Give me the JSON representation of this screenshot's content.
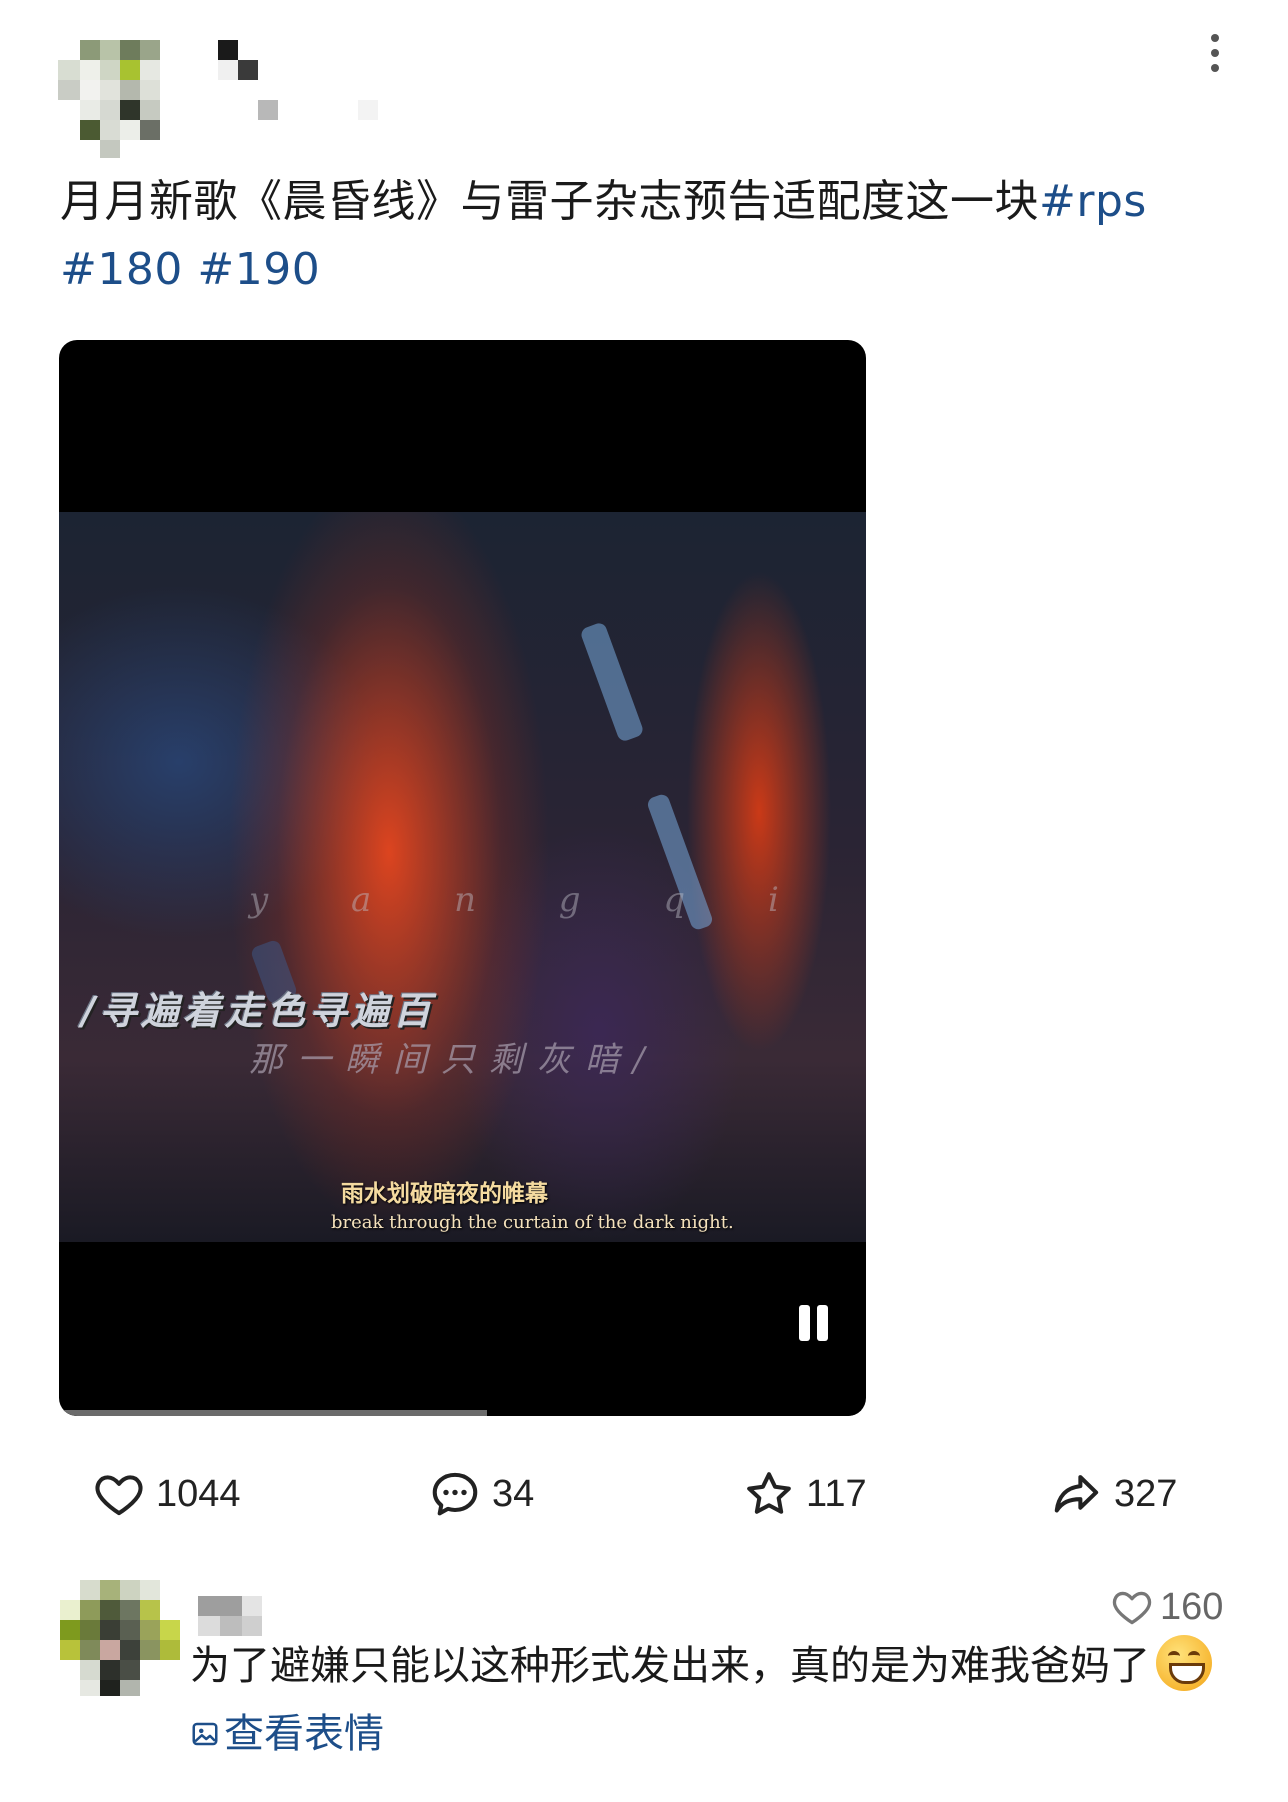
{
  "post": {
    "text_main": "月月新歌《晨昏线》与雷子杂志预告适配度这一块",
    "hashtag_rps": "#rps",
    "hashtag_180": "#180",
    "hashtag_190": "#190"
  },
  "video": {
    "watermark": "y a n g q i",
    "lyric_overlay_1": "/寻遍着走色寻遍百",
    "lyric_overlay_2": "那一瞬间只剩灰暗/",
    "subtitle_cn": "雨水划破暗夜的帷幕",
    "subtitle_en": "break through the curtain of the dark night.",
    "progress": 0.53,
    "state": "playing"
  },
  "actions": {
    "likes": "1044",
    "comments": "34",
    "favorites": "117",
    "shares": "327"
  },
  "comment": {
    "text_part1": "为了避嫌只能以这种形式发出来，真的是为难我爸妈了",
    "sticker_link": "查看表情",
    "likes": "160"
  },
  "colors": {
    "link": "#1d4e89",
    "text": "#1a1a1a",
    "video_bg": "#000000"
  },
  "icons": [
    "more-icon",
    "heart-icon",
    "comment-icon",
    "star-icon",
    "share-icon",
    "pause-icon",
    "image-icon",
    "grin-emoji-icon"
  ]
}
